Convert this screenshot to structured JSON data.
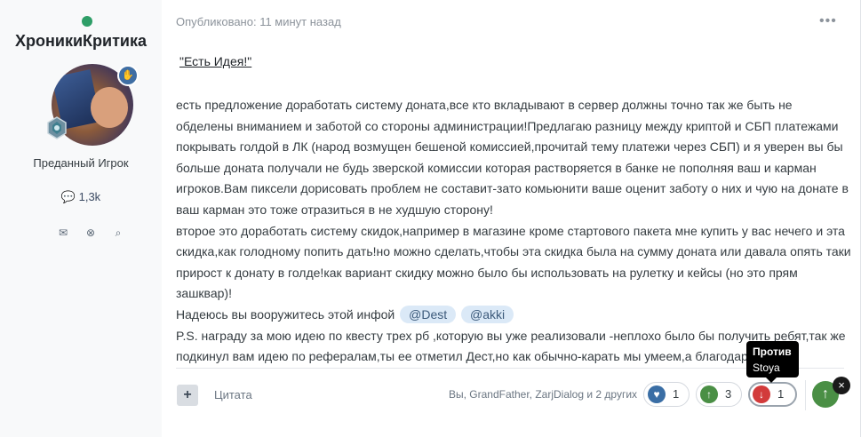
{
  "author": {
    "name": "ХроникиКритика",
    "rank": "Преданный Игрок",
    "posts": "1,3k",
    "avatar_icon": "user-avatar",
    "badge_icon": "hand-icon",
    "rank_icon": "rank-crest-icon"
  },
  "post": {
    "published": "Опубликовано: 11 минут назад",
    "menu_icon": "dots-menu-icon",
    "title": "\"Есть Идея!\"",
    "paragraph1": "есть предложение доработать систему доната,все кто вкладывают в сервер должны точно так же быть не обделены вниманием и заботой со стороны администрации!Предлагаю разницу между криптой и СБП платежами покрывать голдой в ЛК (народ возмущен бешеной комиссией,прочитай тему платежи через СБП) и я уверен вы бы больше доната получали не будь зверской комиссии которая растворяется в банке не пополняя ваш и карман игроков.Вам пиксели дорисовать проблем не составит-зато комьюнити ваше оценит заботу о них и чую на донате в ваш карман это тоже отразиться в не худшую сторону!",
    "paragraph2": "второе это доработать систему скидок,например в магазине кроме стартового пакета мне купить у вас нечего и эта скидка,как голодному попить дать!но можно сделать,чтобы эта скидка была на сумму доната или давала опять таки прирост к донату в голде!как вариант скидку можно было бы использовать на рулетку и кейсы (но это прям зашквар)!",
    "paragraph3_prefix": "Надеюсь вы вооружитесь этой инфой",
    "mention1": "@Dest",
    "mention2": "@akki",
    "paragraph4": "P.S. награду за мою идею по квесту трех рб ,которую вы уже реализовали -неплохо было бы получить ребят,так же подкинул вам идею по рефералам,ты ее отметил Дест,но как обычно-карать мы умеем,а благодарить нет)!"
  },
  "footer": {
    "quote_label": "Цитата",
    "likers": "Вы, GrandFather, ZarjDialog и 2 других",
    "reactions": [
      {
        "name": "like",
        "icon": "heart-icon",
        "count": "1",
        "color": "#3a6ea5"
      },
      {
        "name": "agree",
        "icon": "arrow-up-icon",
        "count": "3",
        "color": "#4a8f45"
      },
      {
        "name": "disagree",
        "icon": "arrow-down-icon",
        "count": "1",
        "color": "#d23b3b"
      }
    ],
    "tooltip_title": "Против",
    "tooltip_user": "Stoya"
  },
  "colors": {
    "online": "#2e9e67",
    "mention_bg": "#dbe9f7",
    "tooltip_bg": "#000000"
  }
}
